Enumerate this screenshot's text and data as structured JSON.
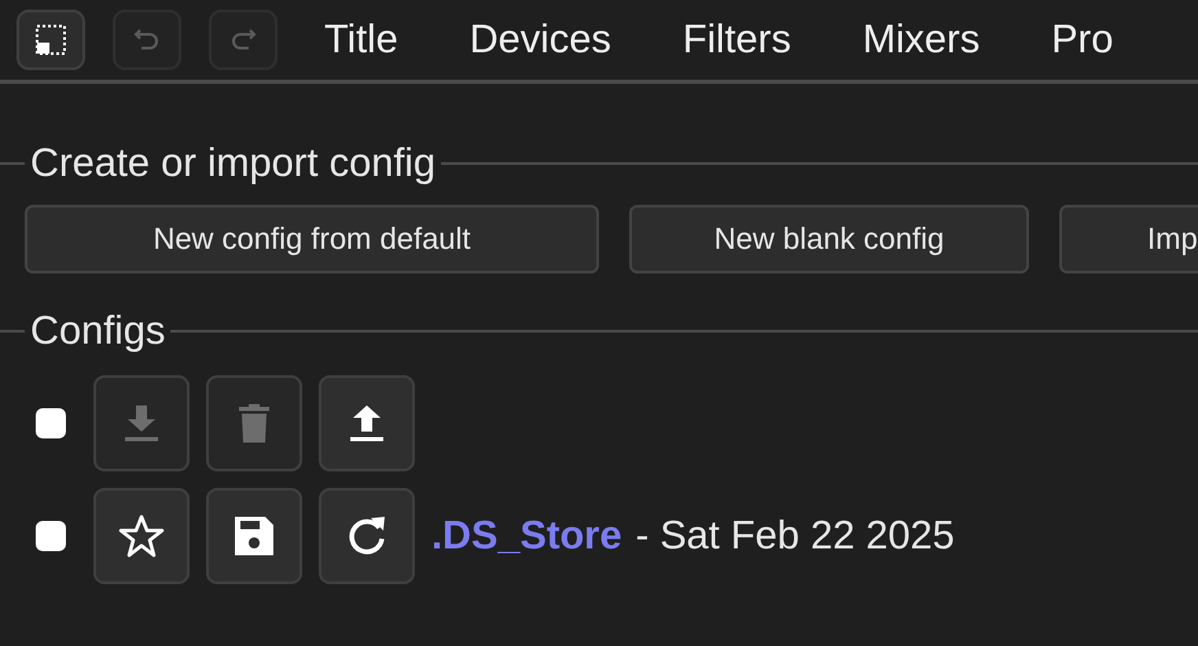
{
  "toolbar": [
    {
      "kind": "screen",
      "disabled": false
    },
    {
      "kind": "undo",
      "disabled": true
    },
    {
      "kind": "redo",
      "disabled": true
    }
  ],
  "tabs": [
    {
      "label": "Title"
    },
    {
      "label": "Devices"
    },
    {
      "label": "Filters"
    },
    {
      "label": "Mixers"
    },
    {
      "label": "Pro"
    }
  ],
  "create_section": {
    "title": "Create or import config",
    "buttons": [
      "New config from default",
      "New blank config",
      "Imp"
    ]
  },
  "configs_section": {
    "title": "Configs",
    "header_row": {
      "checked": false,
      "actions": [
        {
          "kind": "download",
          "disabled": true
        },
        {
          "kind": "delete",
          "disabled": true
        },
        {
          "kind": "upload",
          "disabled": false
        }
      ]
    },
    "rows": [
      {
        "checked": false,
        "actions": [
          {
            "kind": "star",
            "disabled": false
          },
          {
            "kind": "save",
            "disabled": false
          },
          {
            "kind": "reload",
            "disabled": false
          }
        ],
        "name": ".DS_Store",
        "date": "- Sat Feb 22 2025"
      }
    ]
  }
}
